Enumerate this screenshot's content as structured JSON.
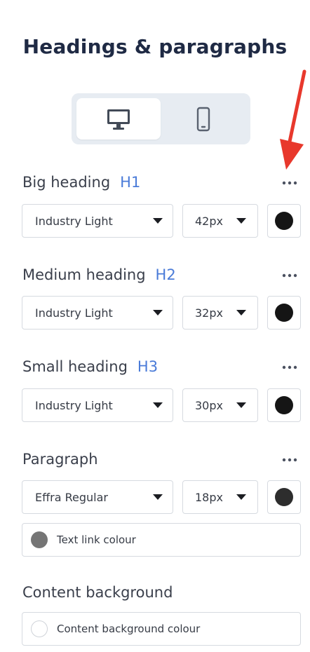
{
  "panel": {
    "title": "Headings & paragraphs"
  },
  "device_toggle": {
    "options": [
      {
        "name": "desktop",
        "icon": "desktop-icon",
        "selected": true
      },
      {
        "name": "mobile",
        "icon": "mobile-icon",
        "selected": false
      }
    ]
  },
  "sections": {
    "h1": {
      "label": "Big heading",
      "tag": "H1",
      "font": "Industry Light",
      "size": "42px",
      "color": "#151515"
    },
    "h2": {
      "label": "Medium heading",
      "tag": "H2",
      "font": "Industry Light",
      "size": "32px",
      "color": "#151515"
    },
    "h3": {
      "label": "Small heading",
      "tag": "H3",
      "font": "Industry Light",
      "size": "30px",
      "color": "#151515"
    },
    "paragraph": {
      "label": "Paragraph",
      "font": "Effra Regular",
      "size": "18px",
      "color": "#2d2d2d",
      "link": {
        "label": "Text link colour",
        "color": "#757575"
      }
    },
    "content_background": {
      "label": "Content background",
      "field": {
        "label": "Content background colour",
        "color": "#ffffff"
      }
    }
  },
  "colors": {
    "accent": "#4a7bd8",
    "arrow": "#e8382c",
    "toggle_bg": "#e7ecf2",
    "border": "#d6dae0"
  }
}
